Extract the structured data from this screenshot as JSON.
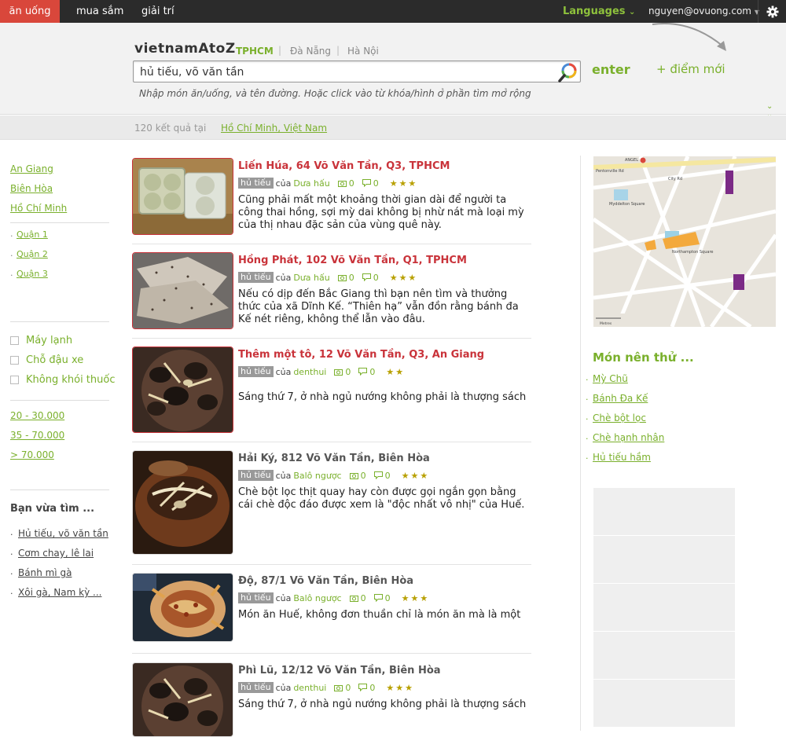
{
  "nav": {
    "tabs": [
      "ăn uống",
      "mua sắm",
      "giải trí"
    ],
    "languages": "Languages",
    "user": "nguyen@ovuong.com"
  },
  "header": {
    "logo": "vietnamAtoZ",
    "cities": [
      "TPHCM",
      "Đà Nẵng",
      "Hà Nội"
    ],
    "search_value": "hủ tiếu, võ văn tần",
    "enter_label": "enter",
    "new_place": "+ điểm mới",
    "hint": "Nhập món ăn/uống, và tên đường. Hoặc click vào từ khóa/hình ở phần tìm mở rộng"
  },
  "results": {
    "count_text": "120 kết quả tại",
    "location": "Hồ Chí Minh, Việt Nam"
  },
  "sidebar": {
    "provinces": [
      "An Giang",
      "Biên Hòa",
      "Hồ Chí Minh"
    ],
    "districts": [
      "Quận 1",
      "Quận 2",
      "Quận 3"
    ],
    "amenities": [
      "Máy lạnh",
      "Chỗ đậu xe",
      "Không khói thuốc"
    ],
    "prices": [
      "20 - 30.000",
      "35 - 70.000",
      "> 70.000"
    ],
    "recent_title": "Bạn vừa tìm ...",
    "recent": [
      "Hủ tiếu, võ văn tần",
      "Cơm chay, lê lai",
      "Bánh mì gà",
      "Xôi gà, Nam kỳ ..."
    ]
  },
  "listings": [
    {
      "title": "Liến Húa, 64 Võ Văn Tần, Q3, TPHCM",
      "tag": "hủ tiếu",
      "of": "của",
      "author": "Dưa hấu",
      "photos": "0",
      "comments": "0",
      "stars": "★★★",
      "desc": "Cũng phải mất một khoảng thời gian dài để người ta công thai hồng, sợi mỳ dai không bị nhừ nát mà loại mỳ của thị nhau đặc sản của vùng quê này."
    },
    {
      "title": "Hồng Phát, 102 Võ Văn Tần, Q1, TPHCM",
      "tag": "hủ tiếu",
      "of": "của",
      "author": "Dưa hấu",
      "photos": "0",
      "comments": "0",
      "stars": "★★★",
      "desc": "Nếu có dịp đến Bắc Giang thì bạn nên tìm và thưởng thức của xã Dĩnh Kế. “Thiên hạ” vẫn đồn rằng bánh đa Kế nét riêng, không thể lẫn vào đâu."
    },
    {
      "title": "Thêm một tô, 12 Võ Văn Tần, Q3, An Giang",
      "tag": "hủ tiếu",
      "of": "của",
      "author": "denthui",
      "photos": "0",
      "comments": "0",
      "stars": "★★",
      "desc": "Sáng thứ 7, ở nhà ngủ nướng không phải là thượng sách"
    },
    {
      "title": "Hải Ký, 812 Võ Văn Tần, Biên Hòa",
      "tag": "hủ tiếu",
      "of": "của",
      "author": "Balô ngược",
      "photos": "0",
      "comments": "0",
      "stars": "★★★",
      "desc": "Chè bột lọc thịt quay hay còn được gọi ngắn gọn bằng cái chè độc đáo được xem là \"độc nhất vô nhị\" của Huế."
    },
    {
      "title": "Độ, 87/1 Võ Văn Tần, Biên Hòa",
      "tag": "hủ tiếu",
      "of": "của",
      "author": "Balô ngược",
      "photos": "0",
      "comments": "0",
      "stars": "★★★",
      "desc": "Món ăn Huế, không đơn thuần chỉ là món ăn mà là một"
    },
    {
      "title": "Phì Lũ, 12/12 Võ Văn Tần, Biên Hòa",
      "tag": "hủ tiếu",
      "of": "của",
      "author": "denthui",
      "photos": "0",
      "comments": "0",
      "stars": "★★★",
      "desc": "Sáng thứ 7, ở nhà ngủ nướng không phải là thượng sách"
    }
  ],
  "right": {
    "map_labels": [
      "ANGEL",
      "Pentonville Rd",
      "City Rd",
      "Myddelton Square",
      "Northampton Square",
      "Metres"
    ],
    "try_title": "Món nên thử ...",
    "try_items": [
      "Mỳ Chũ",
      "Bánh Đa Kế",
      "Chè bột lọc",
      "Chè hạnh nhân",
      "Hủ tiếu hầm"
    ]
  }
}
